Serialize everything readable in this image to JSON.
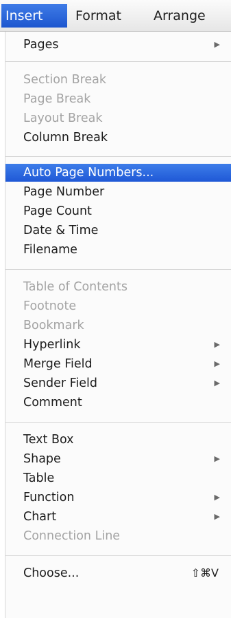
{
  "menubar": {
    "items": [
      {
        "label": "Insert"
      },
      {
        "label": "Format"
      },
      {
        "label": "Arrange"
      }
    ]
  },
  "menu": {
    "pages": {
      "label": "Pages",
      "submenu_icon": "triangle-right"
    },
    "section_break": {
      "label": "Section Break"
    },
    "page_break": {
      "label": "Page Break"
    },
    "layout_break": {
      "label": "Layout Break"
    },
    "column_break": {
      "label": "Column Break"
    },
    "auto_page_numbers": {
      "label": "Auto Page Numbers..."
    },
    "page_number": {
      "label": "Page Number"
    },
    "page_count": {
      "label": "Page Count"
    },
    "date_time": {
      "label": "Date & Time"
    },
    "filename": {
      "label": "Filename"
    },
    "table_of_contents": {
      "label": "Table of Contents"
    },
    "footnote": {
      "label": "Footnote"
    },
    "bookmark": {
      "label": "Bookmark"
    },
    "hyperlink": {
      "label": "Hyperlink",
      "submenu_icon": "triangle-right"
    },
    "merge_field": {
      "label": "Merge Field",
      "submenu_icon": "triangle-right"
    },
    "sender_field": {
      "label": "Sender Field",
      "submenu_icon": "triangle-right"
    },
    "comment": {
      "label": "Comment"
    },
    "text_box": {
      "label": "Text Box"
    },
    "shape": {
      "label": "Shape",
      "submenu_icon": "triangle-right"
    },
    "table": {
      "label": "Table"
    },
    "function": {
      "label": "Function",
      "submenu_icon": "triangle-right"
    },
    "chart": {
      "label": "Chart",
      "submenu_icon": "triangle-right"
    },
    "connection_line": {
      "label": "Connection Line"
    },
    "choose": {
      "label": "Choose...",
      "shortcut": "⇧⌘V"
    }
  },
  "colors": {
    "highlight": "#2a63dc",
    "disabled_text": "#a3a3a3"
  }
}
